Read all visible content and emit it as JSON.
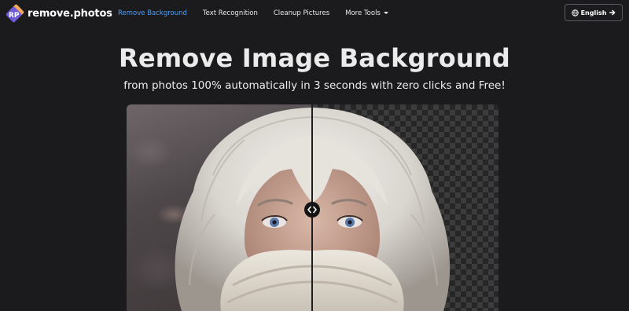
{
  "brand": {
    "name": "remove.photos",
    "mark_text": "RP",
    "accent": "#4d9ef7",
    "mark_colors": [
      "#6e5bd8",
      "#f2a85a"
    ]
  },
  "nav": {
    "links": [
      {
        "label": "Remove Background",
        "active": true
      },
      {
        "label": "Text Recognition",
        "active": false
      },
      {
        "label": "Cleanup Pictures",
        "active": false
      },
      {
        "label": "More Tools",
        "active": false,
        "dropdown": true
      }
    ],
    "language_button": {
      "label": "English",
      "icon": "globe-icon",
      "trailing_icon": "arrow-right-icon"
    }
  },
  "hero": {
    "title": "Remove Image Background",
    "subtitle": "from photos 100% automatically in 3 seconds with zero clicks and Free!"
  },
  "comparison": {
    "left_side": "original photo",
    "right_side": "transparent background",
    "slider_position": 0.5,
    "handle_icon": "left-right-arrows-icon"
  }
}
